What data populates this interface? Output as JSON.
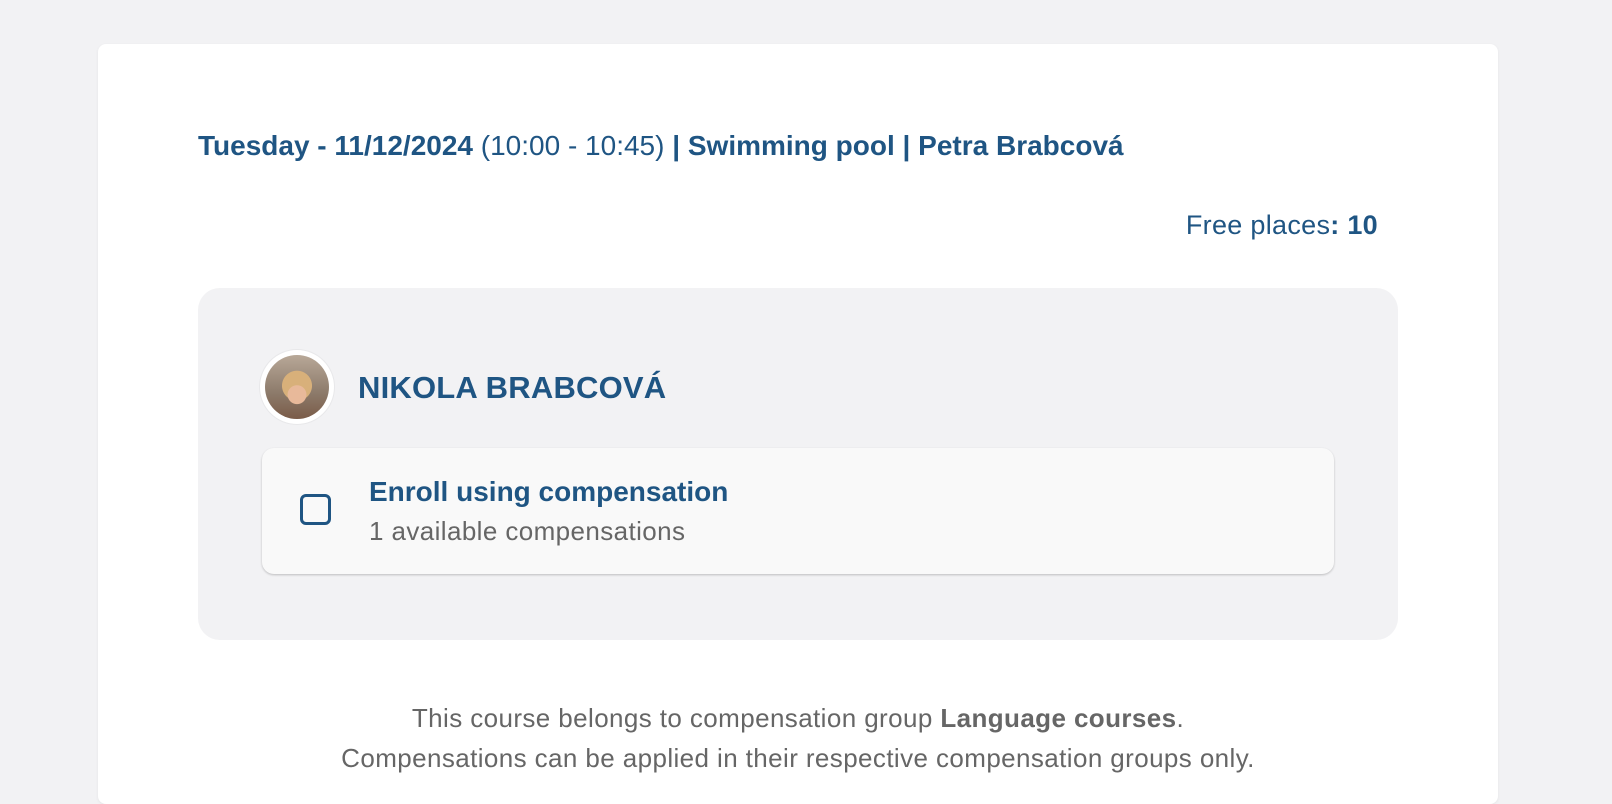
{
  "lesson": {
    "day_date": "Tuesday - 11/12/2024",
    "time": "(10:00 - 10:45)",
    "separator1": " | ",
    "location": "Swimming pool",
    "separator2": " | ",
    "instructor": "Petra Brabcová"
  },
  "free_places": {
    "label": "Free places",
    "colon": ": ",
    "value": "10"
  },
  "participant": {
    "name": "NIKOLA BRABCOVÁ",
    "avatar_icon": "user-photo"
  },
  "compensation_option": {
    "title": "Enroll using compensation",
    "subtitle": "1 available compensations",
    "checked": false
  },
  "footer": {
    "line1_prefix": "This course belongs to compensation group ",
    "group_name": "Language courses",
    "line1_suffix": ".",
    "line2": "Compensations can be applied in their respective compensation groups only."
  },
  "colors": {
    "accent": "#1f5583",
    "muted_text": "#666666",
    "background": "#f2f2f4"
  }
}
